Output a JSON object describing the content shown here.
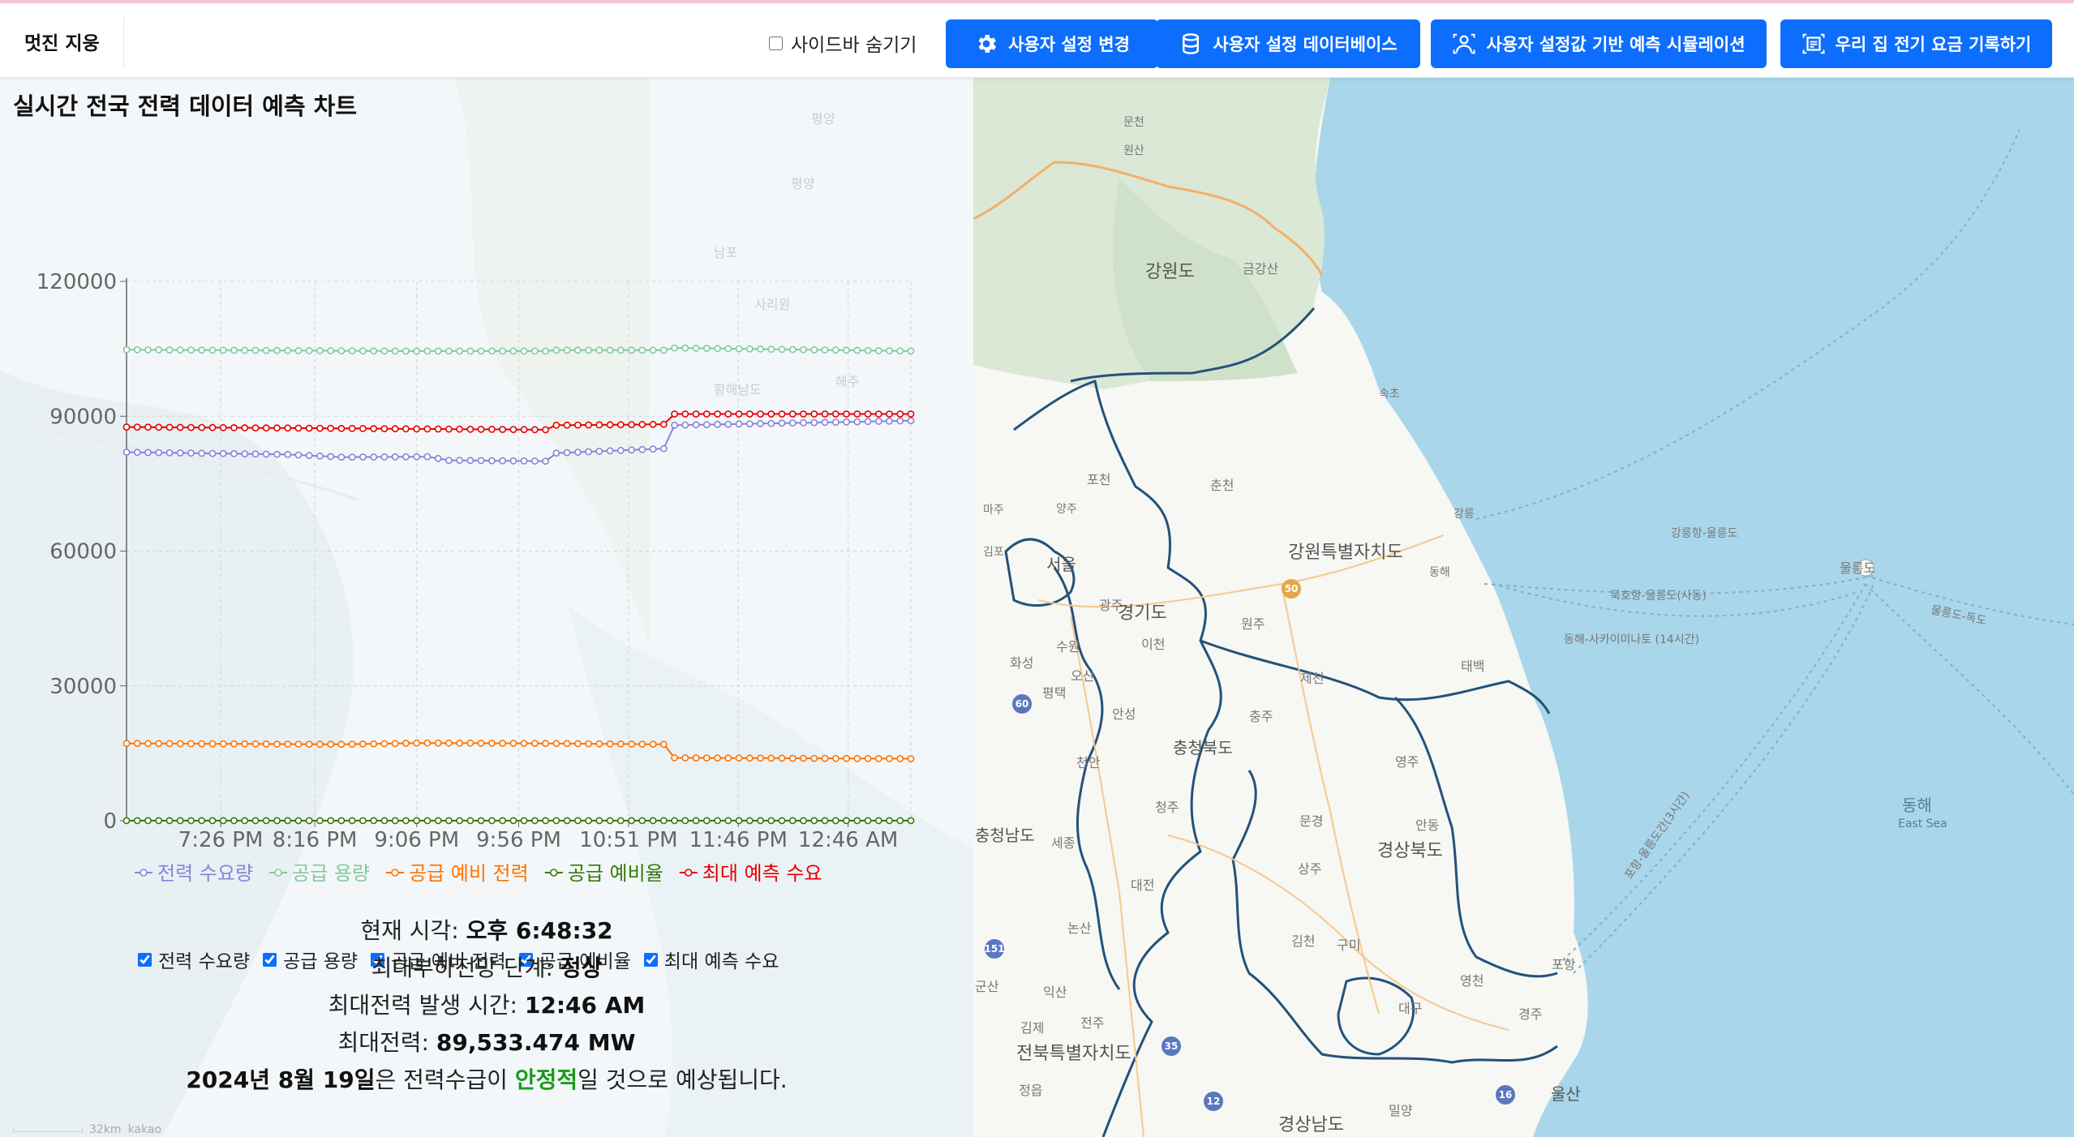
{
  "header": {
    "brand": "멋진 지웅",
    "sidebar_toggle_label": "사이드바 숨기기",
    "buttons": [
      {
        "label": "사용자 설정 변경",
        "icon": "gear-icon"
      },
      {
        "label": "사용자 설정 데이터베이스",
        "icon": "database-icon"
      },
      {
        "label": "사용자 설정값 기반 예측 시뮬레이션",
        "icon": "person-scan-icon"
      },
      {
        "label": "우리 집 전기 요금 기록하기",
        "icon": "receipt-scan-icon"
      }
    ]
  },
  "panel": {
    "title": "실시간 전국 전력 데이터 예측 차트"
  },
  "chart_data": {
    "type": "line",
    "x_ticks": [
      "7:26 PM",
      "8:16 PM",
      "9:06 PM",
      "9:56 PM",
      "10:51 PM",
      "11:46 PM",
      "12:46 AM"
    ],
    "y_ticks": [
      0,
      30000,
      60000,
      90000,
      120000
    ],
    "ylim": [
      0,
      120000
    ],
    "grid": true,
    "legend_position": "bottom",
    "series": [
      {
        "name": "전력 수요량",
        "color": "#8884d8",
        "segments": [
          [
            0,
            82000
          ],
          [
            15,
            81500
          ],
          [
            20,
            80900
          ],
          [
            28,
            81000
          ],
          [
            30,
            80200
          ],
          [
            39,
            80000
          ],
          [
            40,
            81800
          ],
          [
            50,
            82800
          ],
          [
            51,
            88000
          ],
          [
            73,
            89000
          ]
        ]
      },
      {
        "name": "공급 용량",
        "color": "#82ca9d",
        "segments": [
          [
            0,
            104800
          ],
          [
            25,
            104500
          ],
          [
            39,
            104500
          ],
          [
            40,
            104700
          ],
          [
            50,
            104700
          ],
          [
            51,
            105200
          ],
          [
            73,
            104500
          ]
        ]
      },
      {
        "name": "공급 예비 전력",
        "color": "#ff7300",
        "segments": [
          [
            0,
            17200
          ],
          [
            20,
            17000
          ],
          [
            28,
            17300
          ],
          [
            39,
            17200
          ],
          [
            50,
            17000
          ],
          [
            51,
            14000
          ],
          [
            73,
            13800
          ]
        ]
      },
      {
        "name": "공급 예비율",
        "color": "#387908",
        "segments": [
          [
            0,
            21
          ],
          [
            50,
            20
          ],
          [
            51,
            15
          ],
          [
            73,
            15
          ]
        ]
      },
      {
        "name": "최대 예측 수요",
        "color": "#e60000",
        "segments": [
          [
            0,
            87600
          ],
          [
            39,
            87000
          ],
          [
            40,
            88000
          ],
          [
            50,
            88200
          ],
          [
            51,
            90500
          ],
          [
            73,
            90500
          ]
        ]
      }
    ]
  },
  "checkboxes": [
    "전력 수요량",
    "공급 용량",
    "공급 예비 전력",
    "공급 예비율",
    "최대 예측 수요"
  ],
  "status": {
    "current_time_label": "현재 시각: ",
    "current_time_value": "오후 6:48:32",
    "peak_stage_label": "최대부하전망 단계: ",
    "peak_stage_value": "정상",
    "peak_time_label": "최대전력 발생 시간: ",
    "peak_time_value": "12:46 AM",
    "peak_power_label": "최대전력: ",
    "peak_power_value": "89,533.474 MW",
    "forecast_date": "2024년 8월 19일",
    "forecast_mid": "은 전력수급이 ",
    "forecast_status": "안정적",
    "forecast_end": "일 것으로 예상됩니다."
  },
  "scale": {
    "label": "32km",
    "brand": "kakao"
  },
  "map": {
    "labels_left": [
      "평양",
      "남포",
      "황해남도",
      "사리원",
      "해주"
    ],
    "labels": [
      "문천",
      "원산",
      "강원도",
      "금강산",
      "속초",
      "포천",
      "춘천",
      "양주",
      "마주",
      "김포",
      "서울",
      "강원특별자치도",
      "강릉",
      "동해",
      "광주",
      "경기도",
      "원주",
      "화성",
      "수원",
      "이천",
      "오산",
      "평택",
      "안성",
      "제천",
      "태백",
      "충주",
      "천안",
      "충청북도",
      "영주",
      "청주",
      "충청남도",
      "문경",
      "안동",
      "세종",
      "대전",
      "상주",
      "경상북도",
      "논산",
      "김천",
      "구미",
      "익산",
      "군산",
      "영천",
      "대구",
      "김제",
      "전주",
      "경주",
      "포항",
      "전북특별자치도",
      "정읍",
      "밀양",
      "울산",
      "경상남도",
      "울릉도",
      "강릉항-울릉도",
      "묵호항-울릉도(사동)",
      "동해-사카이미나토 (14시간)",
      "울릉도-독도",
      "포항-울릉도간(3시간)"
    ],
    "sea_label": "동해",
    "sea_label_en": "East Sea",
    "road_numbers": [
      "50",
      "60",
      "151",
      "35",
      "12",
      "16"
    ]
  }
}
